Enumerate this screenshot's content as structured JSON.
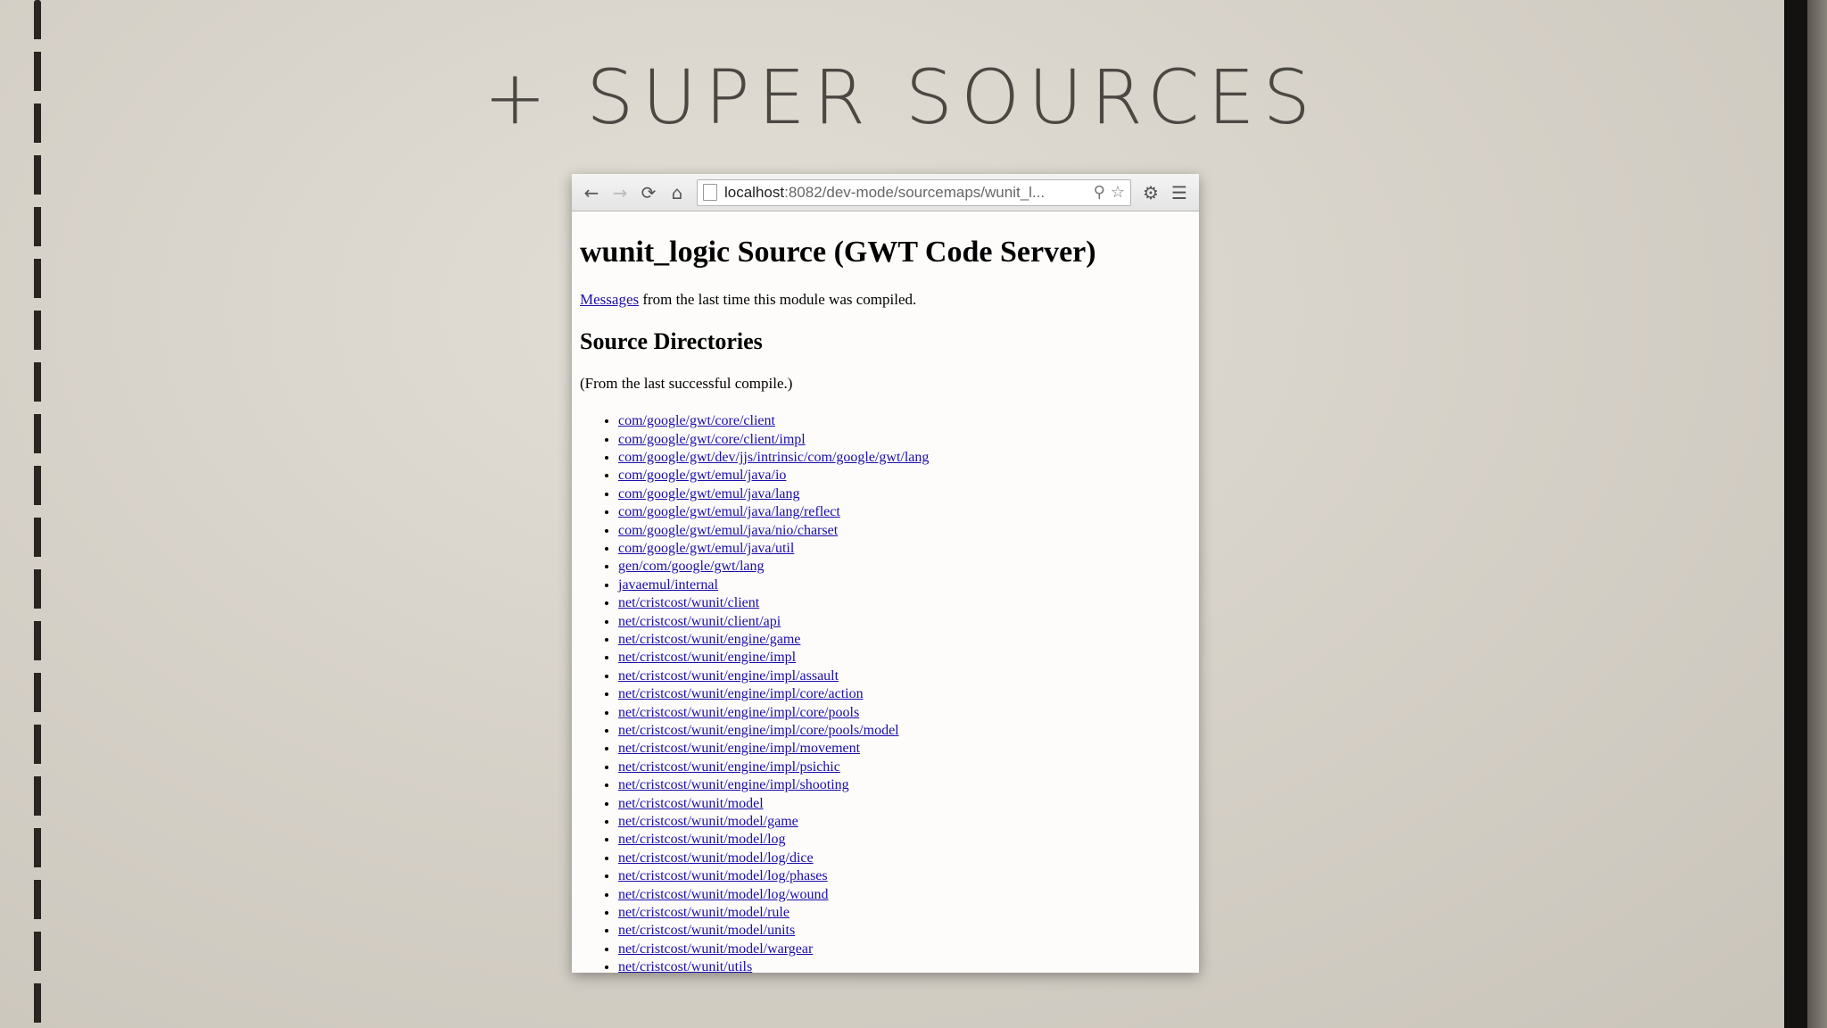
{
  "slide": {
    "title": "+ SUPER SOURCES"
  },
  "browser": {
    "toolbar": {
      "back_icon": "←",
      "forward_icon": "→",
      "reload_icon": "⟳",
      "home_icon": "⌂",
      "url_host": "localhost",
      "url_path": ":8082/dev-mode/sourcemaps/wunit_l...",
      "search_icon": "⚲",
      "star_icon": "☆",
      "settings_icon": "⚙",
      "menu_icon": "☰"
    },
    "page": {
      "title": "wunit_logic Source (GWT Code Server)",
      "messages_link": "Messages",
      "messages_text": " from the last time this module was compiled.",
      "section_title": "Source Directories",
      "note": "(From the last successful compile.)",
      "directories": [
        "com/google/gwt/core/client",
        "com/google/gwt/core/client/impl",
        "com/google/gwt/dev/jjs/intrinsic/com/google/gwt/lang",
        "com/google/gwt/emul/java/io",
        "com/google/gwt/emul/java/lang",
        "com/google/gwt/emul/java/lang/reflect",
        "com/google/gwt/emul/java/nio/charset",
        "com/google/gwt/emul/java/util",
        "gen/com/google/gwt/lang",
        "javaemul/internal",
        "net/cristcost/wunit/client",
        "net/cristcost/wunit/client/api",
        "net/cristcost/wunit/engine/game",
        "net/cristcost/wunit/engine/impl",
        "net/cristcost/wunit/engine/impl/assault",
        "net/cristcost/wunit/engine/impl/core/action",
        "net/cristcost/wunit/engine/impl/core/pools",
        "net/cristcost/wunit/engine/impl/core/pools/model",
        "net/cristcost/wunit/engine/impl/movement",
        "net/cristcost/wunit/engine/impl/psichic",
        "net/cristcost/wunit/engine/impl/shooting",
        "net/cristcost/wunit/model",
        "net/cristcost/wunit/model/game",
        "net/cristcost/wunit/model/log",
        "net/cristcost/wunit/model/log/dice",
        "net/cristcost/wunit/model/log/phases",
        "net/cristcost/wunit/model/log/wound",
        "net/cristcost/wunit/model/rule",
        "net/cristcost/wunit/model/units",
        "net/cristcost/wunit/model/wargear",
        "net/cristcost/wunit/utils"
      ]
    }
  }
}
